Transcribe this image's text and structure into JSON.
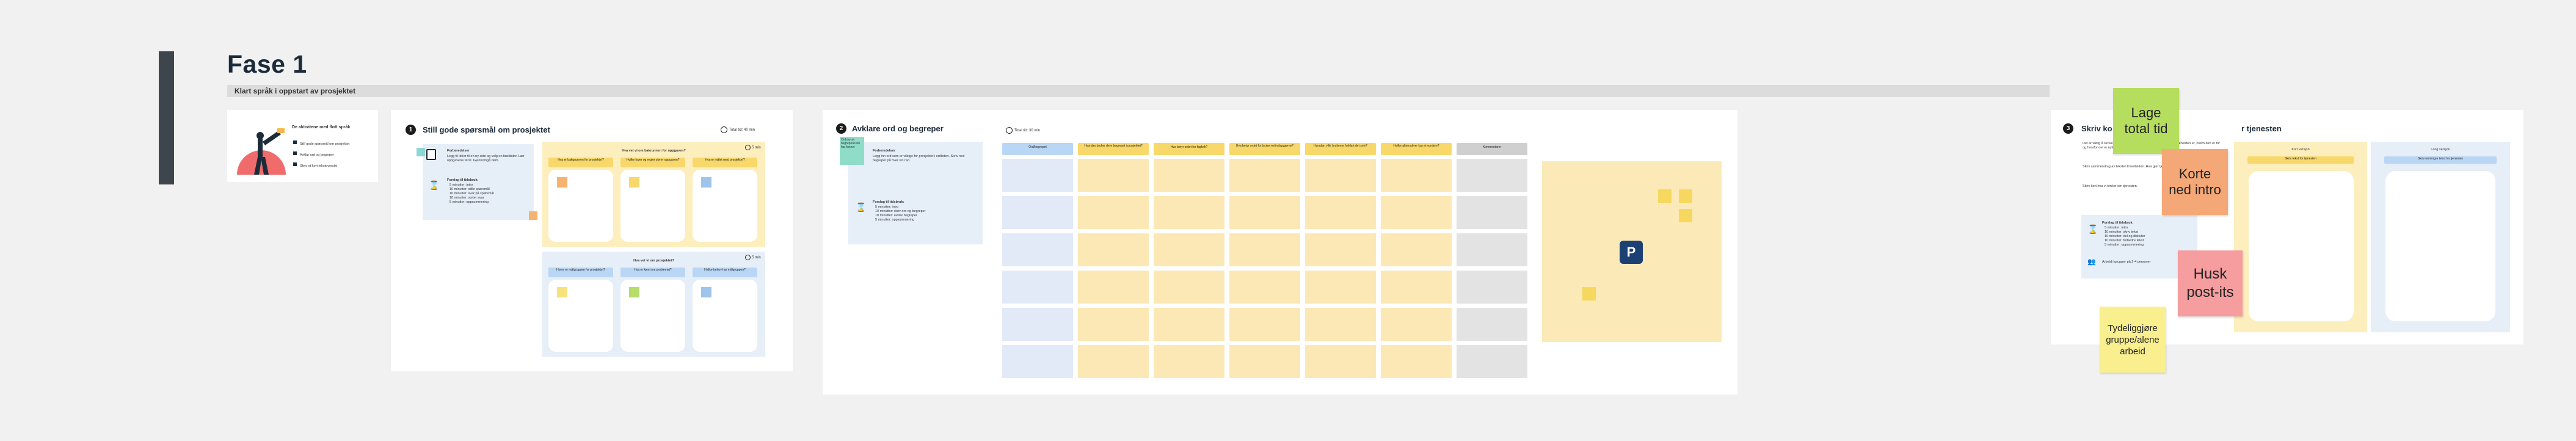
{
  "board": {
    "phase_title": "Fase 1",
    "subtitle": "Klart språk i oppstart av prosjektet"
  },
  "intro_card": {
    "heading": "De aktivitene med flott språk",
    "items": [
      "Still gode spørsmål om prosjektet",
      "Avklar ord og begreper",
      "Skriv et kort tekstoversikt"
    ]
  },
  "section1": {
    "number": "1",
    "title": "Still gode spørsmål om prosjektet",
    "timer": "Total tid: 40 min",
    "forberedelser_title": "Forberedelser",
    "forberedelser_text": "Legg til idéer til en ny side og velg en fasilitator. Lær oppgavene først. Gjennomgå dem.",
    "forslag_title": "Forslag til tidsbruk:",
    "forslag_items": [
      "5 minutter: intro",
      "10 minutter: stille spørsmål",
      "10 minutter: svar på spørsmål",
      "10 minutter: sorter svar",
      "5 minutter: oppsummering"
    ],
    "upper_header": "Hva vet vi om bakrunnen for oppgaven?",
    "upper_columns": [
      "Hva er bakgrunnen for prosjektet?",
      "Hvilke lover og regler styrer oppgaven?",
      "Hva er målet med prosjektet?"
    ],
    "lower_header": "Hva vet vi om prosjektet?",
    "lower_columns": [
      "Hvem er målgruppen for prosjektet?",
      "Hva er kjent om problemet?",
      "Hvilke behov har målgruppen?"
    ],
    "panel_timer": "5 min"
  },
  "section2": {
    "number": "2",
    "title": "Avklare ord og begreper",
    "timer": "Total tid: 30 min",
    "green_note": "Ordsky av begrepene du har funnet",
    "forberedelser_title": "Forberedelser",
    "forberedelser_text": "Legg inn ord som er viktige for prosjektet i ordlisten. Skriv ned begreper på hver sin rad.",
    "forslag_title": "Forslag til tidsbruk:",
    "forslag_items": [
      "5 minutter: intro",
      "10 minutter: skriv ord og begreper",
      "10 minutter: avklar begreper",
      "5 minutter: oppsummering"
    ],
    "table_headers": [
      "Ord/begrepet",
      "Hvordan bruker dere begrepet i prosjektet?",
      "Hva betyr ordet for fagfolk?",
      "Hva betyr ordet for brukerne/innbyggerne?",
      "Hvordan ville brukerne forklart det selv?",
      "Hvilke alternativer kan vi vurdere?",
      "Hvordan bør vi definere det?",
      "Kommentarer"
    ],
    "row_count": 6,
    "parking_label": "P"
  },
  "section3": {
    "number": "3",
    "title_visible": "Skriv ko",
    "title_tail": "r tjenesten",
    "para1": "Det er viktig å skrive korte og presise tekster. Skriv kort om hva tjenesten er, hvem den er for og hvorfor det er nyttig for brukeren.",
    "para2": "Skriv sammendrag av tekster til nettsiden. Hva gjør tjenesten? Hvem er den for?",
    "para3": "Skriv kort hva vi tenker om tjenesten.",
    "forslag_title": "Forslag til tidsbruk:",
    "forslag_items": [
      "5 minutter: intro",
      "10 minutter: skriv tekst",
      "10 minutter: del og diskuter",
      "10 minutter: forbedre tekst",
      "5 minutter: oppsummering"
    ],
    "people_note": "Arbeid i grupper på 2-4 personer",
    "col_left_label": "Kort versjon",
    "col_left_header": "Skriv tekst for tjenesten",
    "col_right_label": "Lang versjon",
    "col_right_header": "Skriv en lengre tekst for tjenesten"
  },
  "stickies": [
    {
      "text": "Lage total tid",
      "color": "#b5dd5e"
    },
    {
      "text": "Korte ned intro",
      "color": "#f5a877"
    },
    {
      "text": "Husk post-its",
      "color": "#f59d9f"
    },
    {
      "text": "Tydeliggjøre gruppe/alene arbeid",
      "color": "#f9ef8e"
    }
  ],
  "colors": {
    "accent_dark": "#1c2b3a",
    "panel_yellow": "#fdeebd",
    "panel_blue": "#e6eef8",
    "parking_blue": "#1c3f74"
  }
}
